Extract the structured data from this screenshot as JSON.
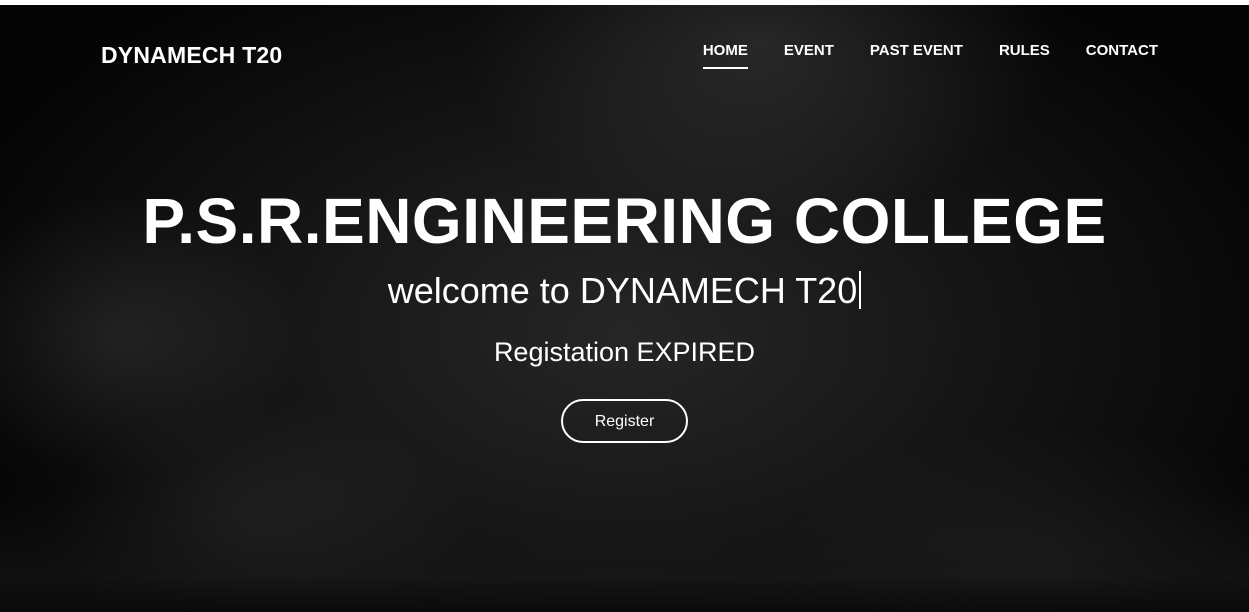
{
  "navbar": {
    "brand": "DYNAMECH T20",
    "links": [
      {
        "label": "HOME",
        "active": true
      },
      {
        "label": "EVENT",
        "active": false
      },
      {
        "label": "PAST EVENT",
        "active": false
      },
      {
        "label": "RULES",
        "active": false
      },
      {
        "label": "CONTACT",
        "active": false
      }
    ]
  },
  "hero": {
    "title": "P.S.R.ENGINEERING COLLEGE",
    "welcome": "welcome to DYNAMECH T20",
    "status": "Registation EXPIRED",
    "register_label": "Register"
  },
  "colors": {
    "background": "#141414",
    "text": "#ffffff"
  }
}
